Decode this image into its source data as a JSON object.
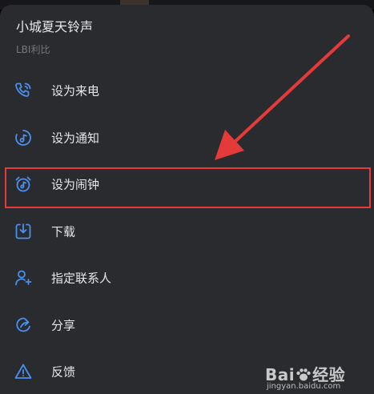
{
  "sheet": {
    "title": "小城夏天铃声",
    "artist": "LBI利比"
  },
  "menu": [
    {
      "label": "设为来电",
      "icon": "phone-icon"
    },
    {
      "label": "设为通知",
      "icon": "music-note-icon"
    },
    {
      "label": "设为闹钟",
      "icon": "alarm-clock-icon"
    },
    {
      "label": "下载",
      "icon": "download-icon"
    },
    {
      "label": "指定联系人",
      "icon": "add-contact-icon"
    },
    {
      "label": "分享",
      "icon": "share-icon"
    },
    {
      "label": "反馈",
      "icon": "warning-icon"
    }
  ],
  "watermark": {
    "main_left": "Bai",
    "main_right": "经验",
    "url": "jingyan.baidu.com"
  },
  "colors": {
    "sheet_background": "#2a2b2f",
    "icon_blue": "#4a90f0",
    "annotation_red": "#e43a3a"
  }
}
